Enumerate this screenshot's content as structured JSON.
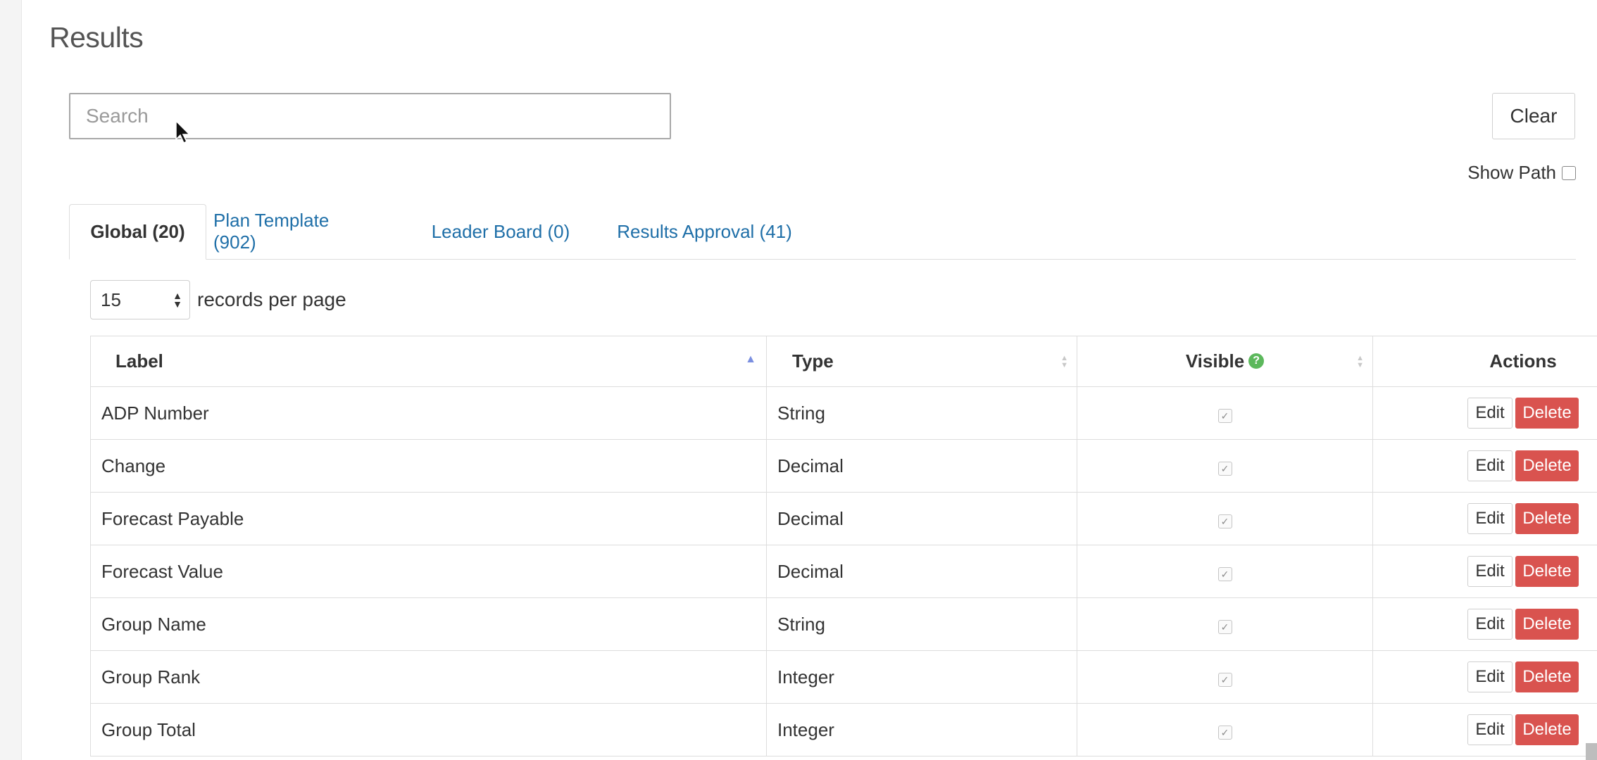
{
  "page": {
    "title": "Results"
  },
  "search": {
    "placeholder": "Search",
    "value": ""
  },
  "clear_label": "Clear",
  "show_path": {
    "label": "Show Path",
    "checked": false
  },
  "tabs": [
    {
      "label": "Global (20)",
      "active": true
    },
    {
      "label": "Plan Template (902)",
      "active": false
    },
    {
      "label": "Leader Board (0)",
      "active": false
    },
    {
      "label": "Results Approval (41)",
      "active": false
    }
  ],
  "per_page": {
    "value": "15",
    "label": "records per page"
  },
  "table": {
    "headers": {
      "label": "Label",
      "type": "Type",
      "visible": "Visible",
      "actions": "Actions"
    },
    "edit_label": "Edit",
    "delete_label": "Delete",
    "rows": [
      {
        "label": "ADP Number",
        "type": "String",
        "visible": true
      },
      {
        "label": "Change",
        "type": "Decimal",
        "visible": true
      },
      {
        "label": "Forecast Payable",
        "type": "Decimal",
        "visible": true
      },
      {
        "label": "Forecast Value",
        "type": "Decimal",
        "visible": true
      },
      {
        "label": "Group Name",
        "type": "String",
        "visible": true
      },
      {
        "label": "Group Rank",
        "type": "Integer",
        "visible": true
      },
      {
        "label": "Group Total",
        "type": "Integer",
        "visible": true
      }
    ]
  },
  "colors": {
    "link": "#1f6fa8",
    "danger": "#d9534f",
    "help": "#5cb85c"
  }
}
